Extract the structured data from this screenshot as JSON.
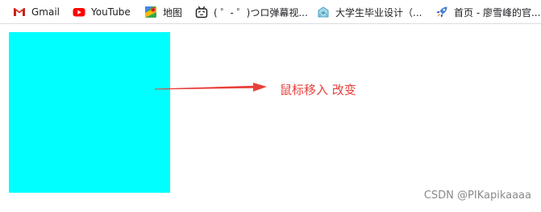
{
  "bookmarks": [
    {
      "label": "Gmail",
      "icon": "gmail-icon"
    },
    {
      "label": "YouTube",
      "icon": "youtube-icon"
    },
    {
      "label": "地图",
      "icon": "maps-icon"
    },
    {
      "label": "( ゜- ゜)つロ弹幕视...",
      "icon": "bilibili-icon"
    },
    {
      "label": "大学生毕业设计（...",
      "icon": "graduation-icon"
    },
    {
      "label": "首页 - 廖雪峰的官...",
      "icon": "rocket-icon"
    }
  ],
  "content": {
    "box_color": "#00ffff",
    "annotation": "鼠标移入 改变",
    "annotation_color": "#e8403a"
  },
  "watermark": "CSDN @PIKapikaaaa"
}
